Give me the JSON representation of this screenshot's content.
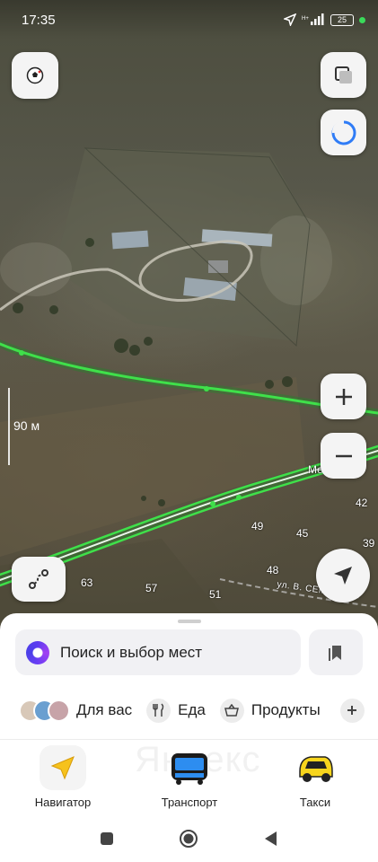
{
  "status_bar": {
    "time": "17:35",
    "battery": "25"
  },
  "map": {
    "scale_label": "90 м",
    "poi_label": "Мечеть",
    "street_label": "ул. В. СЕМЕНОВА",
    "house_numbers": [
      {
        "n": "42"
      },
      {
        "n": "49"
      },
      {
        "n": "45"
      },
      {
        "n": "39"
      },
      {
        "n": "48"
      },
      {
        "n": "63"
      },
      {
        "n": "57"
      },
      {
        "n": "51"
      }
    ]
  },
  "search": {
    "placeholder": "Поиск и выбор мест"
  },
  "chips": [
    {
      "label": "Для вас",
      "icon": "avatars-icon"
    },
    {
      "label": "Еда",
      "icon": "fork-knife-icon"
    },
    {
      "label": "Продукты",
      "icon": "basket-icon"
    }
  ],
  "nav": {
    "items": [
      {
        "label": "Навигатор",
        "icon": "navigator-arrow-icon"
      },
      {
        "label": "Транспорт",
        "icon": "bus-icon"
      },
      {
        "label": "Такси",
        "icon": "taxi-icon"
      }
    ],
    "watermark": "Яндекс"
  },
  "colors": {
    "route_green": "#3fe04a",
    "accent_purple": "#6a3ef4",
    "taxi_yellow": "#f7d51d"
  }
}
